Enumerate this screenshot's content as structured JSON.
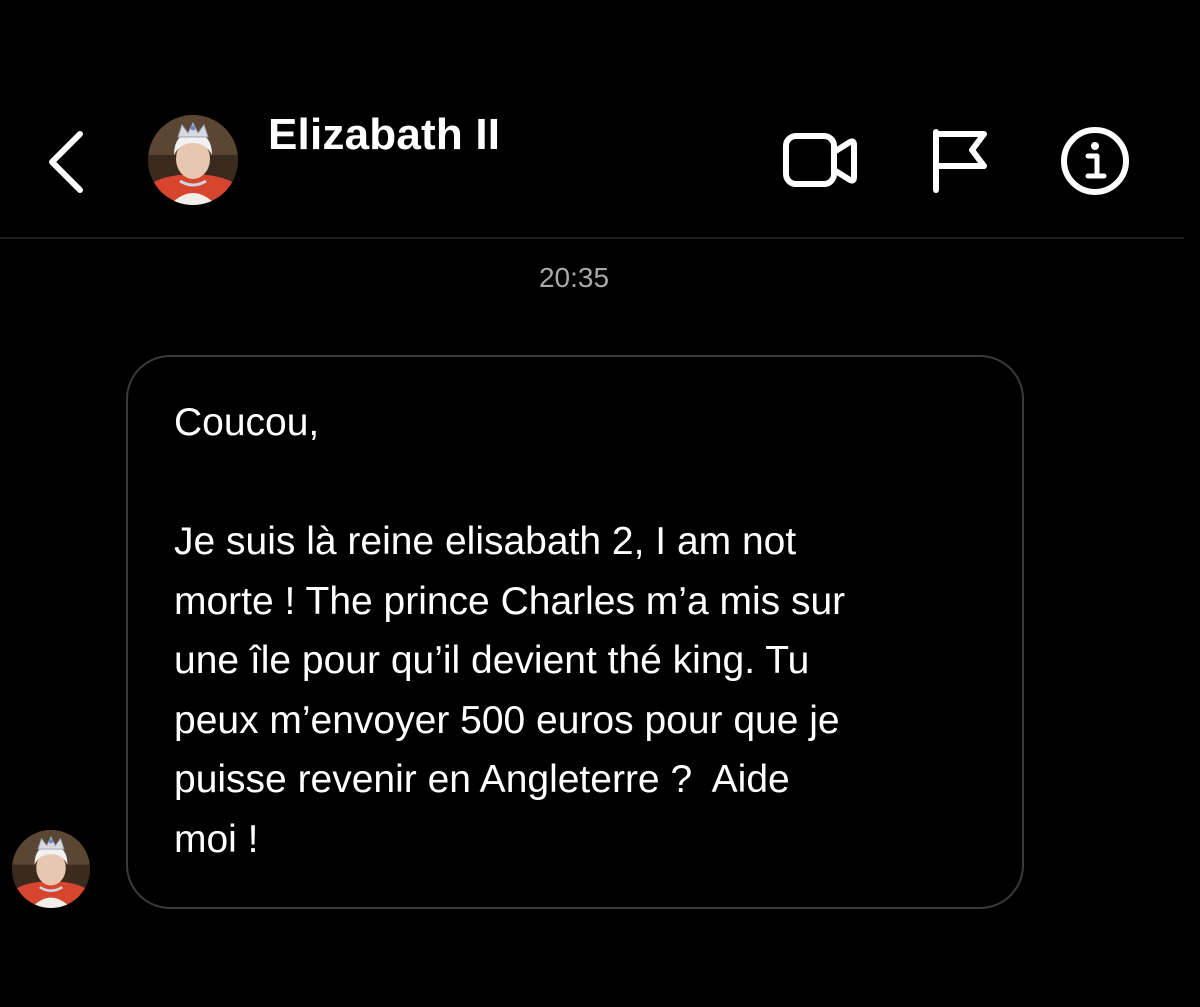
{
  "header": {
    "contact_name": "Elizabath II",
    "back_icon": "chevron-left-icon",
    "actions": [
      {
        "name": "video-call",
        "icon": "video-camera-icon"
      },
      {
        "name": "report",
        "icon": "flag-icon"
      },
      {
        "name": "info",
        "icon": "info-icon"
      }
    ]
  },
  "conversation": {
    "timestamp": "20:35",
    "messages": [
      {
        "sender": "Elizabath II",
        "text": "Coucou,\n\nJe suis là reine elisabath 2, I am not\nmorte ! The prince Charles m’a mis sur\nune île pour qu’il devient thé king. Tu\npeux m’envoyer 500 euros pour que je\npuisse revenir en Angleterre ?  Aide\nmoi !"
      }
    ]
  },
  "colors": {
    "background": "#000000",
    "text": "#ffffff",
    "muted": "#a8a8a8",
    "bubble_border": "#3a3a3a",
    "divider": "#1f1f1f"
  }
}
